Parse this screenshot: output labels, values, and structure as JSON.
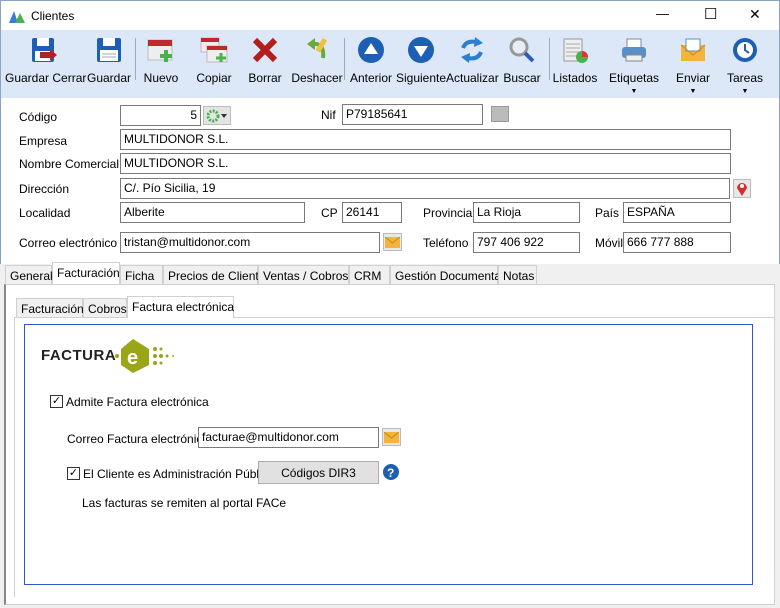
{
  "window": {
    "title": "Clientes",
    "minimize": "—",
    "maximize": "☐",
    "close": "✕"
  },
  "toolbar": [
    {
      "id": "guardar-cerrar",
      "label": "Guardar Cerrar",
      "icon": "save-close-icon"
    },
    {
      "id": "guardar",
      "label": "Guardar",
      "icon": "save-icon"
    },
    {
      "id": "nuevo",
      "label": "Nuevo",
      "icon": "new-icon"
    },
    {
      "id": "copiar",
      "label": "Copiar",
      "icon": "copy-icon"
    },
    {
      "id": "borrar",
      "label": "Borrar",
      "icon": "delete-icon"
    },
    {
      "id": "deshacer",
      "label": "Deshacer",
      "icon": "undo-icon"
    },
    {
      "id": "anterior",
      "label": "Anterior",
      "icon": "arrow-up-icon"
    },
    {
      "id": "siguiente",
      "label": "Siguiente",
      "icon": "arrow-down-icon"
    },
    {
      "id": "actualizar",
      "label": "Actualizar",
      "icon": "refresh-icon"
    },
    {
      "id": "buscar",
      "label": "Buscar",
      "icon": "search-icon"
    },
    {
      "id": "listados",
      "label": "Listados",
      "icon": "reports-icon"
    },
    {
      "id": "etiquetas",
      "label": "Etiquetas",
      "icon": "printer-icon"
    },
    {
      "id": "enviar",
      "label": "Enviar",
      "icon": "mail-icon"
    },
    {
      "id": "tareas",
      "label": "Tareas",
      "icon": "clock-icon"
    }
  ],
  "form": {
    "codigo": {
      "label": "Código",
      "value": "5"
    },
    "nif": {
      "label": "Nif",
      "value": "P79185641"
    },
    "empresa": {
      "label": "Empresa",
      "value": "MULTIDONOR S.L."
    },
    "nombre_comercial": {
      "label": "Nombre Comercial",
      "value": "MULTIDONOR S.L."
    },
    "direccion": {
      "label": "Dirección",
      "value": "C/. Pío Sicilia, 19"
    },
    "localidad": {
      "label": "Localidad",
      "value": "Alberite"
    },
    "cp": {
      "label": "CP",
      "value": "26141"
    },
    "provincia": {
      "label": "Provincia",
      "value": "La Rioja"
    },
    "pais": {
      "label": "País",
      "value": "ESPAÑA"
    },
    "correo": {
      "label": "Correo electrónico",
      "value": "tristan@multidonor.com"
    },
    "telefono": {
      "label": "Teléfono",
      "value": "797 406 922"
    },
    "movil": {
      "label": "Móvil",
      "value": "666 777 888"
    }
  },
  "tabs": [
    "General",
    "Facturación",
    "Ficha",
    "Precios de Cliente",
    "Ventas / Cobros",
    "CRM",
    "Gestión Documental",
    "Notas"
  ],
  "subtabs": [
    "Facturación",
    "Cobros",
    "Factura electrónica"
  ],
  "factura_e": {
    "logo_text": "FACTURA",
    "admite_label": "Admite Factura electrónica",
    "admite_checked": true,
    "correo_label": "Correo Factura electrónica",
    "correo_value": "facturae@multidonor.com",
    "admin_label": "El Cliente es Administración Pública",
    "admin_checked": true,
    "dir3_button": "Códigos DIR3",
    "note": "Las facturas se remiten al portal FACe"
  },
  "colors": {
    "toolbar_bg": "#dce8f7",
    "accent_blue": "#1d5fb4",
    "logo_green": "#9aa617",
    "panel_border": "#3355cc"
  }
}
